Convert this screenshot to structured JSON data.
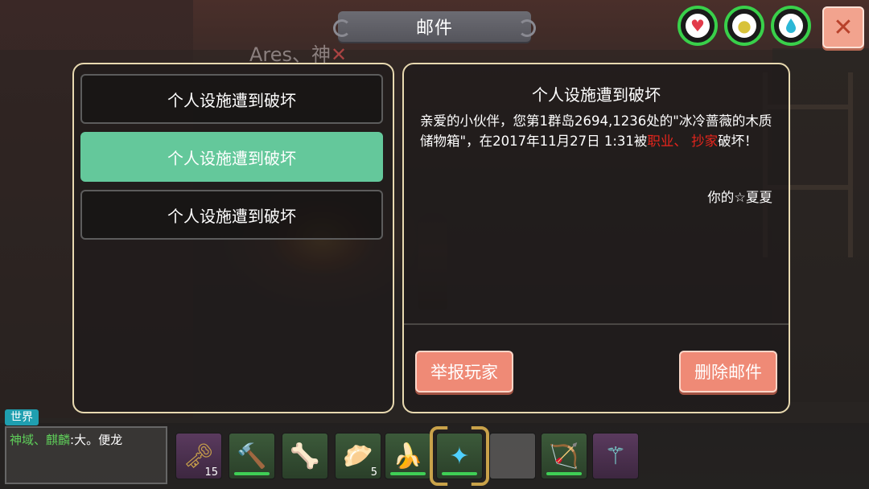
{
  "window": {
    "title": "邮件"
  },
  "player_nametag": {
    "name": "Ares、神",
    "mark": "✕"
  },
  "status_icons": [
    {
      "name": "heart-icon",
      "glyph": "♥",
      "color": "#e23a4a"
    },
    {
      "name": "hunger-icon",
      "glyph": "●",
      "color": "#d8c23a"
    },
    {
      "name": "water-icon",
      "glyph": "💧",
      "color": "#2bb7d6"
    }
  ],
  "close_label": "✕",
  "mail_list": {
    "items": [
      {
        "label": "个人设施遭到破坏"
      },
      {
        "label": "个人设施遭到破坏"
      },
      {
        "label": "个人设施遭到破坏"
      }
    ],
    "selected_index": 1
  },
  "mail_detail": {
    "title": "个人设施遭到破坏",
    "body_part1": "亲爱的小伙伴，您第1群岛2694,1236处的\"冰冷蔷薇的木质储物箱\"，在2017年11月27日 1:31被",
    "body_highlight": "职业、 抄家",
    "body_part2": "破坏！",
    "signature": "你的☆夏夏"
  },
  "buttons": {
    "report": "举报玩家",
    "delete": "删除邮件"
  },
  "chat": {
    "channel": "世界",
    "sender": "神域、麒麟",
    "separator": ":",
    "message": "大。便龙"
  },
  "hotbar": {
    "slots": [
      {
        "icon": "keys-icon",
        "glyph": "🗝",
        "style": "purple",
        "count": "15",
        "durability": false
      },
      {
        "icon": "hammer-icon",
        "glyph": "🔨",
        "style": "green",
        "count": "",
        "durability": true
      },
      {
        "icon": "bone-horn-icon",
        "glyph": "🦴",
        "style": "green",
        "count": "",
        "durability": false
      },
      {
        "icon": "bun-basket-icon",
        "glyph": "🥟",
        "style": "green",
        "count": "5",
        "durability": false
      },
      {
        "icon": "banana-icon",
        "glyph": "🍌",
        "style": "green",
        "count": "",
        "durability": true
      },
      {
        "icon": "magic-staff-icon",
        "glyph": "✦",
        "style": "green",
        "count": "",
        "durability": true,
        "selected": true
      },
      {
        "icon": "empty-slot",
        "glyph": "",
        "style": "empty",
        "count": "",
        "durability": false
      },
      {
        "icon": "bow-icon",
        "glyph": "🏹",
        "style": "green",
        "count": "",
        "durability": true
      },
      {
        "icon": "crystal-staff-icon",
        "glyph": "⚚",
        "style": "purple",
        "count": "",
        "durability": false
      }
    ]
  }
}
